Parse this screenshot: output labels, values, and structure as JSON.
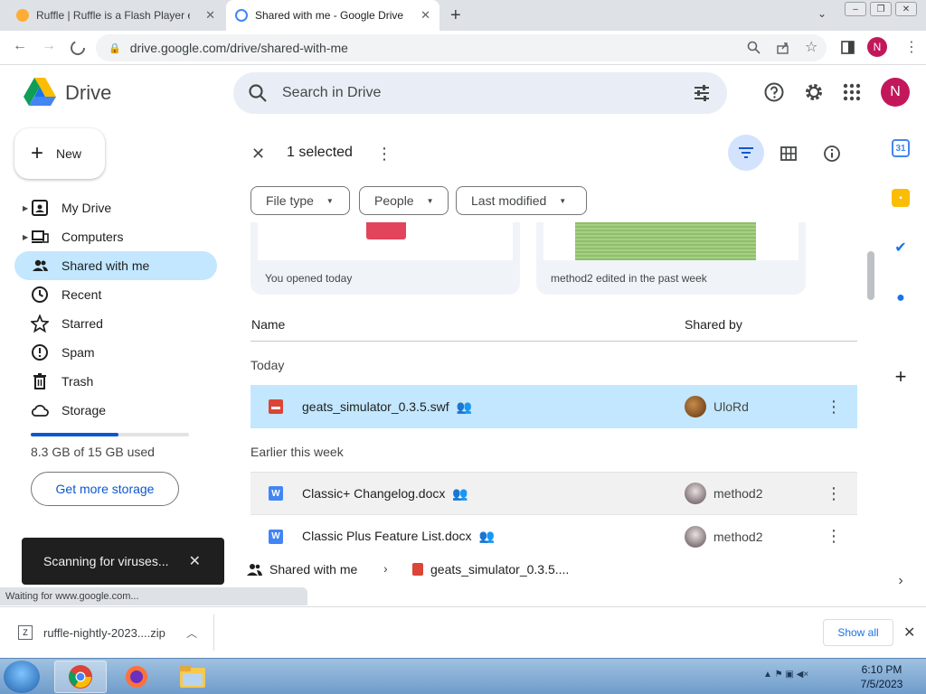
{
  "browser": {
    "tabs": [
      {
        "title": "Ruffle | Ruffle is a Flash Player em",
        "active": false
      },
      {
        "title": "Shared with me - Google Drive",
        "active": true
      }
    ],
    "url": "drive.google.com/drive/shared-with-me",
    "profile_initial": "N"
  },
  "drive": {
    "app_name": "Drive",
    "search_placeholder": "Search in Drive",
    "user_initial": "N",
    "new_label": "New",
    "nav": [
      {
        "label": "My Drive",
        "icon": "my-drive-icon"
      },
      {
        "label": "Computers",
        "icon": "computers-icon"
      },
      {
        "label": "Shared with me",
        "icon": "shared-with-me-icon"
      },
      {
        "label": "Recent",
        "icon": "recent-icon"
      },
      {
        "label": "Starred",
        "icon": "star-icon"
      },
      {
        "label": "Spam",
        "icon": "spam-icon"
      },
      {
        "label": "Trash",
        "icon": "trash-icon"
      },
      {
        "label": "Storage",
        "icon": "cloud-icon"
      }
    ],
    "storage": {
      "text": "8.3 GB of 15 GB used",
      "used_fraction": 0.553,
      "button": "Get more storage"
    },
    "selection": {
      "count_label": "1 selected"
    },
    "filters": [
      "File type",
      "People",
      "Last modified"
    ],
    "suggested": [
      {
        "caption": "You opened today"
      },
      {
        "caption": "method2 edited in the past week"
      }
    ],
    "columns": {
      "name": "Name",
      "shared_by": "Shared by"
    },
    "groups": [
      {
        "label": "Today",
        "files": [
          {
            "name": "geats_simulator_0.3.5.swf",
            "type": "swf",
            "shared_by": "UloRd",
            "selected": true
          }
        ]
      },
      {
        "label": "Earlier this week",
        "files": [
          {
            "name": "Classic+ Changelog.docx",
            "type": "docx",
            "shared_by": "method2",
            "selected": false
          },
          {
            "name": "Classic Plus Feature List.docx",
            "type": "docx",
            "shared_by": "method2",
            "selected": false
          }
        ]
      }
    ],
    "breadcrumb": [
      "Shared with me",
      "geats_simulator_0.3.5...."
    ],
    "toast": "Scanning for viruses..."
  },
  "status_text": "Waiting for www.google.com...",
  "downloads": {
    "file": "ruffle-nightly-2023....zip",
    "show_all": "Show all"
  },
  "taskbar": {
    "time": "6:10 PM",
    "date": "7/5/2023"
  },
  "colors": {
    "accent": "#0b57d0",
    "selected_row": "#c2e7ff",
    "avatar": "#c2185b",
    "file_red": "#db4437",
    "file_blue": "#4285f4"
  }
}
